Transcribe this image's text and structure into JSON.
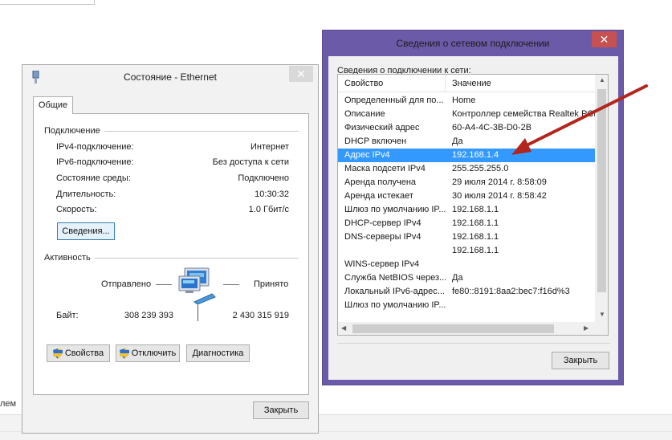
{
  "background": {
    "partial_text": "лем"
  },
  "status_window": {
    "title": "Состояние - Ethernet",
    "tab": "Общие",
    "connection_group": "Подключение",
    "rows": [
      {
        "label": "IPv4-подключение:",
        "value": "Интернет"
      },
      {
        "label": "IPv6-подключение:",
        "value": "Без доступа к сети"
      },
      {
        "label": "Состояние среды:",
        "value": "Подключено"
      },
      {
        "label": "Длительность:",
        "value": "10:30:32"
      },
      {
        "label": "Скорость:",
        "value": "1.0 Гбит/с"
      }
    ],
    "details_button": "Сведения...",
    "activity_group": "Активность",
    "sent_label": "Отправлено",
    "received_label": "Принято",
    "bytes_label": "Байт:",
    "bytes_sent": "308 239 393",
    "bytes_received": "2 430 315 919",
    "properties_button": "Свойства",
    "disable_button": "Отключить",
    "diagnose_button": "Диагностика",
    "close_button": "Закрыть"
  },
  "details_window": {
    "title": "Сведения о сетевом подключении",
    "caption": "Сведения о подключении к сети:",
    "col_property": "Свойство",
    "col_value": "Значение",
    "rows": [
      {
        "property": "Определенный для по...",
        "value": "Home"
      },
      {
        "property": "Описание",
        "value": "Контроллер семейства Realtek PCI"
      },
      {
        "property": "Физический адрес",
        "value": "60-A4-4C-3B-D0-2B"
      },
      {
        "property": "DHCP включен",
        "value": "Да"
      },
      {
        "property": "Адрес IPv4",
        "value": "192.168.1.4"
      },
      {
        "property": "Маска подсети IPv4",
        "value": "255.255.255.0"
      },
      {
        "property": "Аренда получена",
        "value": "29 июля 2014 г. 8:58:09"
      },
      {
        "property": "Аренда истекает",
        "value": "30 июля 2014 г. 8:58:42"
      },
      {
        "property": "Шлюз по умолчанию IP...",
        "value": "192.168.1.1"
      },
      {
        "property": "DHCP-сервер IPv4",
        "value": "192.168.1.1"
      },
      {
        "property": "DNS-серверы IPv4",
        "value": "192.168.1.1"
      },
      {
        "property": "",
        "value": "192.168.1.1"
      },
      {
        "property": "WINS-сервер IPv4",
        "value": ""
      },
      {
        "property": "Служба NetBIOS через...",
        "value": "Да"
      },
      {
        "property": "Локальный IPv6-адрес...",
        "value": "fe80::8191:8aa2:bec7:f16d%3"
      },
      {
        "property": "Шлюз по умолчанию IP...",
        "value": ""
      }
    ],
    "selected_index": 4,
    "close_button": "Закрыть"
  },
  "colors": {
    "selection": "#3399ff",
    "details_frame": "#6b5aa8",
    "details_close": "#c75050",
    "annotation_arrow": "#b3261e"
  }
}
